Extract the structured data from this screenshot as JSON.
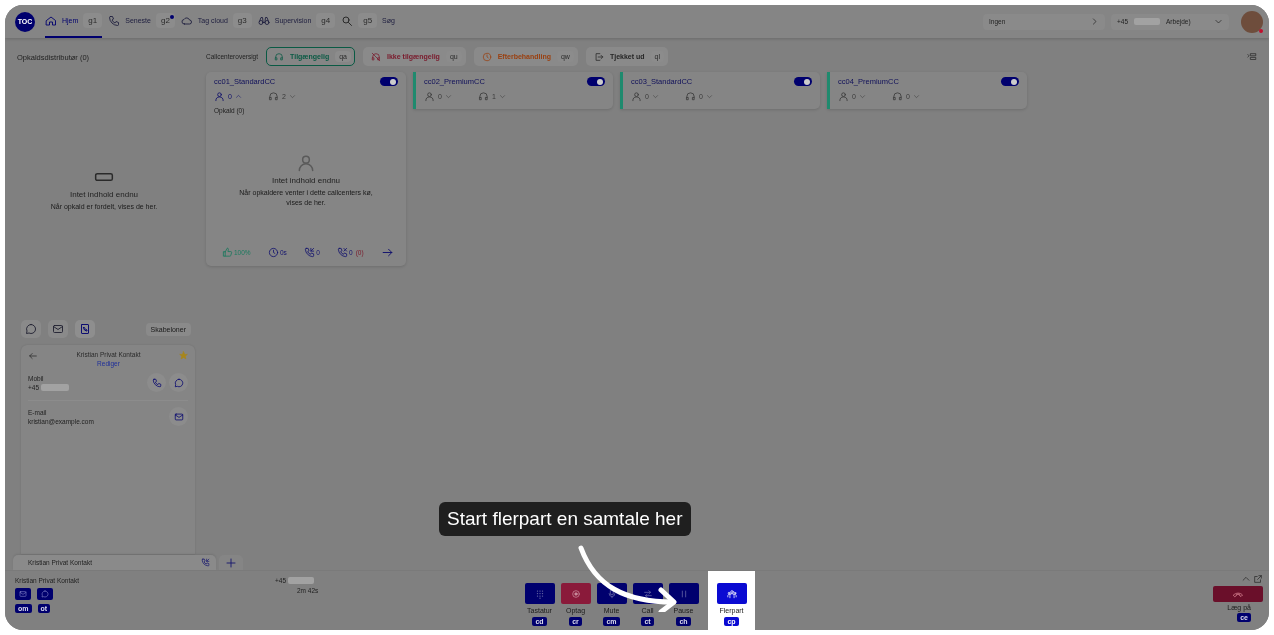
{
  "nav": {
    "logo": "TOC",
    "items": [
      {
        "label": "Hjem",
        "key": "g1",
        "selected": true,
        "unread": false
      },
      {
        "label": "Seneste",
        "key": "g2",
        "selected": false,
        "unread": true
      },
      {
        "label": "Tag cloud",
        "key": "g3",
        "selected": false,
        "unread": false
      },
      {
        "label": "Supervision",
        "key": "g4",
        "selected": false,
        "unread": false
      }
    ],
    "search": {
      "key": "g5",
      "label": "Søg"
    },
    "queue_select": {
      "value": "Ingen"
    },
    "number_select": {
      "prefix": "+45",
      "label": "Arbejde)"
    }
  },
  "distributor": {
    "title": "Opkaldsdistributør (0)",
    "empty_title": "Intet indhold endnu",
    "empty_text": "Når opkald er fordelt, vises de her."
  },
  "overview": {
    "title": "Callcenteroversigt",
    "statuses": [
      {
        "label": "Tilgængelig",
        "key": "qa",
        "color": "#0a5a44",
        "selected": true
      },
      {
        "label": "Ikke tilgængelig",
        "key": "qu",
        "color": "#7a1a2c",
        "selected": false
      },
      {
        "label": "Efterbehandling",
        "key": "qw",
        "color": "#9a4010",
        "selected": false
      },
      {
        "label": "Tjekket ud",
        "key": "ql",
        "color": "#262626",
        "selected": false
      }
    ],
    "callcenters": [
      {
        "name": "cc01_StandardCC",
        "enabled": true,
        "accent": false,
        "expanded": true,
        "agents": "0",
        "headsets": "2",
        "calls_label": "Opkald (0)",
        "empty_title": "Intet indhold endnu",
        "empty_text": "Når opkaldere venter i dette callcenters kø, vises de her.",
        "stats": {
          "satisfaction": "100%",
          "wait": "0s",
          "answered": "0",
          "missed": "0",
          "missed_extra": "(0)"
        }
      },
      {
        "name": "cc02_PremiumCC",
        "enabled": true,
        "accent": true,
        "expanded": false,
        "agents": "0",
        "headsets": "1"
      },
      {
        "name": "cc03_StandardCC",
        "enabled": true,
        "accent": true,
        "expanded": false,
        "agents": "0",
        "headsets": "0"
      },
      {
        "name": "cc04_PremiumCC",
        "enabled": true,
        "accent": true,
        "expanded": false,
        "agents": "0",
        "headsets": "0"
      }
    ]
  },
  "contact": {
    "tabs": [
      {
        "selected": false
      },
      {
        "selected": false
      },
      {
        "selected": true
      }
    ],
    "templates": "Skabeloner",
    "name": "Kristian Privat Kontakt",
    "edit": "Rediger",
    "favorite": true,
    "fields": [
      {
        "kind": "phone",
        "label": "Mobil",
        "value": "+45"
      },
      {
        "kind": "email",
        "label": "E-mail",
        "value": "kristian@example.com"
      }
    ]
  },
  "call_tabs": [
    {
      "label": "Kristian Privat Kontakt",
      "selected": true
    }
  ],
  "call_bar": {
    "name": "Kristian Privat Kontakt",
    "keys": [
      "om",
      "ot"
    ],
    "number_prefix": "+45",
    "duration": "2m 42s",
    "controls": [
      {
        "label": "Tastatur",
        "key": "cd",
        "kind": "dialpad",
        "highlighted": false
      },
      {
        "label": "Optag",
        "key": "cr",
        "kind": "record",
        "highlighted": false
      },
      {
        "label": "Mute",
        "key": "cm",
        "kind": "mute",
        "highlighted": false
      },
      {
        "label": "Call",
        "key": "ct",
        "kind": "transfer",
        "highlighted": false
      },
      {
        "label": "Pause",
        "key": "ch",
        "kind": "pause",
        "highlighted": false
      },
      {
        "label": "Flerpart",
        "key": "cp",
        "kind": "conference",
        "highlighted": true
      }
    ],
    "hangup": {
      "label": "Læg på",
      "key": "ce"
    }
  },
  "tooltip": {
    "text": "Start flerpart en samtale her"
  }
}
